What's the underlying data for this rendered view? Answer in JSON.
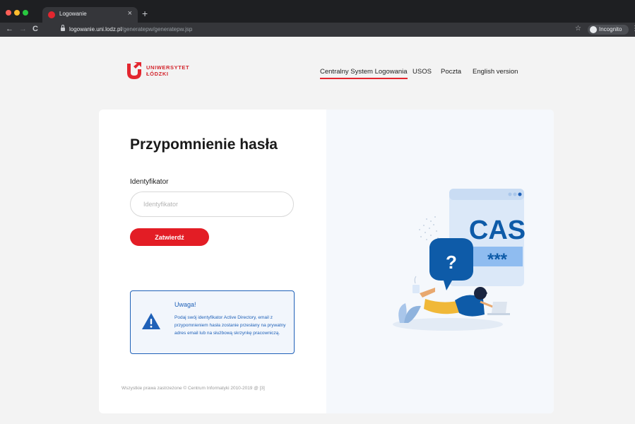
{
  "browser": {
    "tab_title": "Logowanie",
    "tab_close": "×",
    "new_tab": "+",
    "url_host": "logowanie.uni.lodz.pl",
    "url_path": "/generatepw/generatepw.jsp",
    "incognito_label": "Incognito",
    "nav": {
      "back": "←",
      "forward": "→",
      "reload": "C",
      "star": "☆",
      "menu": "⋮"
    },
    "traffic_colors": [
      "#ff5f57",
      "#febc2e",
      "#28c840"
    ]
  },
  "header": {
    "logo_line1": "UNIWERSYTET",
    "logo_line2": "ŁÓDZKI",
    "nav": [
      {
        "label": "Centralny System Logowania",
        "active": true
      },
      {
        "label": "USOS",
        "active": false
      },
      {
        "label": "Poczta",
        "active": false
      },
      {
        "label": "English version",
        "active": false
      }
    ]
  },
  "form": {
    "title": "Przypomnienie hasła",
    "field_label": "Identyfikator",
    "input_placeholder": "Identyfikator",
    "input_value": "",
    "submit_label": "Zatwierdź"
  },
  "notice": {
    "title": "Uwaga!",
    "text": "Podaj swój identyfikator Active Directory, email z przypomnieniem hasła zostanie przesłany na prywatny adres email lub na służbową skrzynkę pracowniczą.",
    "icon": "warning-icon"
  },
  "footer": {
    "copyright": "Wszystkie prawa zastrzeżone © Centrum Informatyki 2010-2019 @ [3]"
  },
  "illustration": {
    "cas_label": "CAS",
    "password_mask": "***",
    "question_mark": "?"
  },
  "colors": {
    "accent_red": "#e31d25",
    "notice_blue": "#1f61b8",
    "illustration_blue": "#0e5ba8"
  }
}
